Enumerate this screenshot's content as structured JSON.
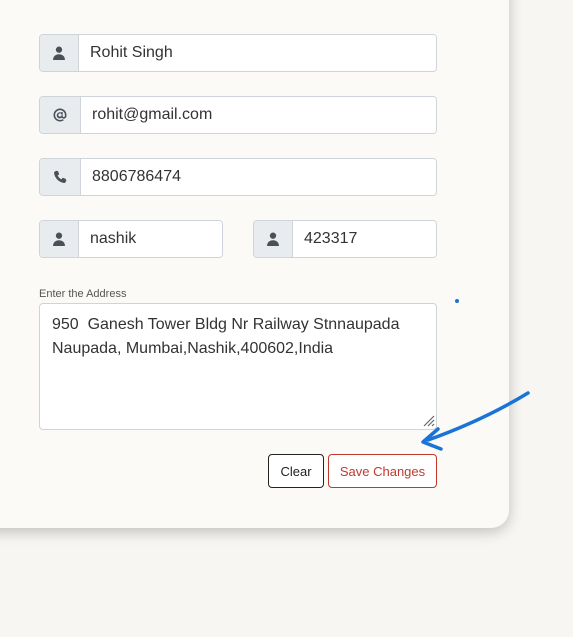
{
  "form": {
    "name": "Rohit Singh",
    "email": "rohit@gmail.com",
    "phone": "8806786474",
    "city": "nashik",
    "pincode": "423317",
    "address_label": "Enter the Address",
    "address": "950  Ganesh Tower Bldg Nr Railway Stnnaupada Naupada, Mumbai,Nashik,400602,India"
  },
  "buttons": {
    "clear_label": "Clear",
    "save_label": "Save Changes"
  },
  "icons": {
    "name": "user-icon",
    "email": "at-icon",
    "phone": "phone-icon",
    "city": "user-icon",
    "pincode": "user-icon"
  },
  "colors": {
    "save_accent": "#c0392b",
    "annotation_arrow": "#1a73d6"
  }
}
